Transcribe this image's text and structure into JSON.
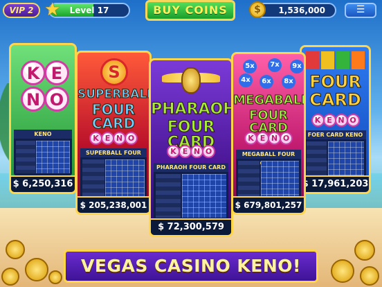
{
  "header": {
    "vip_label": "VIP 2",
    "level_label": "Level 17",
    "level_progress": 0.55,
    "buy_coins_label": "BUY COINS",
    "coin_balance": "1,536,000",
    "coin_symbol": "$",
    "menu_icon": "list-icon"
  },
  "games": [
    {
      "id": "keno",
      "title_balls": [
        "K",
        "E",
        "N",
        "O"
      ],
      "mini_title": "KENO",
      "jackpot": "$ 6,250,316"
    },
    {
      "id": "superball",
      "badge": "S",
      "title": "SUPERBALL\nFOUR CARD",
      "title_line1": "SUPERBALL",
      "title_line2": "FOUR CARD",
      "keno_balls": [
        "K",
        "E",
        "N",
        "O"
      ],
      "mini_title": "SUPERBALL FOUR CARD",
      "jackpot": "$ 205,238,001"
    },
    {
      "id": "pharaoh",
      "title_line1": "PHARAOH",
      "title_line2": "FOUR CARD",
      "keno_balls": [
        "K",
        "E",
        "N",
        "O"
      ],
      "mini_title": "PHARAOH FOUR CARD",
      "jackpot": "$ 72,300,579"
    },
    {
      "id": "megaball",
      "multipliers": [
        "5x",
        "7x",
        "9x",
        "4x",
        "6x",
        "8x"
      ],
      "title_line1": "MEGABALL",
      "title_line2": "FOUR CARD",
      "keno_balls": [
        "K",
        "E",
        "N",
        "O"
      ],
      "mini_title": "MEGABALL FOUR CARD",
      "jackpot": "$ 679,801,257"
    },
    {
      "id": "fourcard",
      "title_line1": "FOUR",
      "title_line2": "CARD",
      "keno_balls": [
        "K",
        "E",
        "N",
        "O"
      ],
      "mini_title": "FOER CARD KENO",
      "jackpot": "$ 17,961,203"
    }
  ],
  "banner": "VEGAS CASINO KENO!",
  "colors": {
    "accent_gold": "#ffd54a",
    "buy_green": "#1a9e2a",
    "banner_purple": "#3e1396"
  }
}
